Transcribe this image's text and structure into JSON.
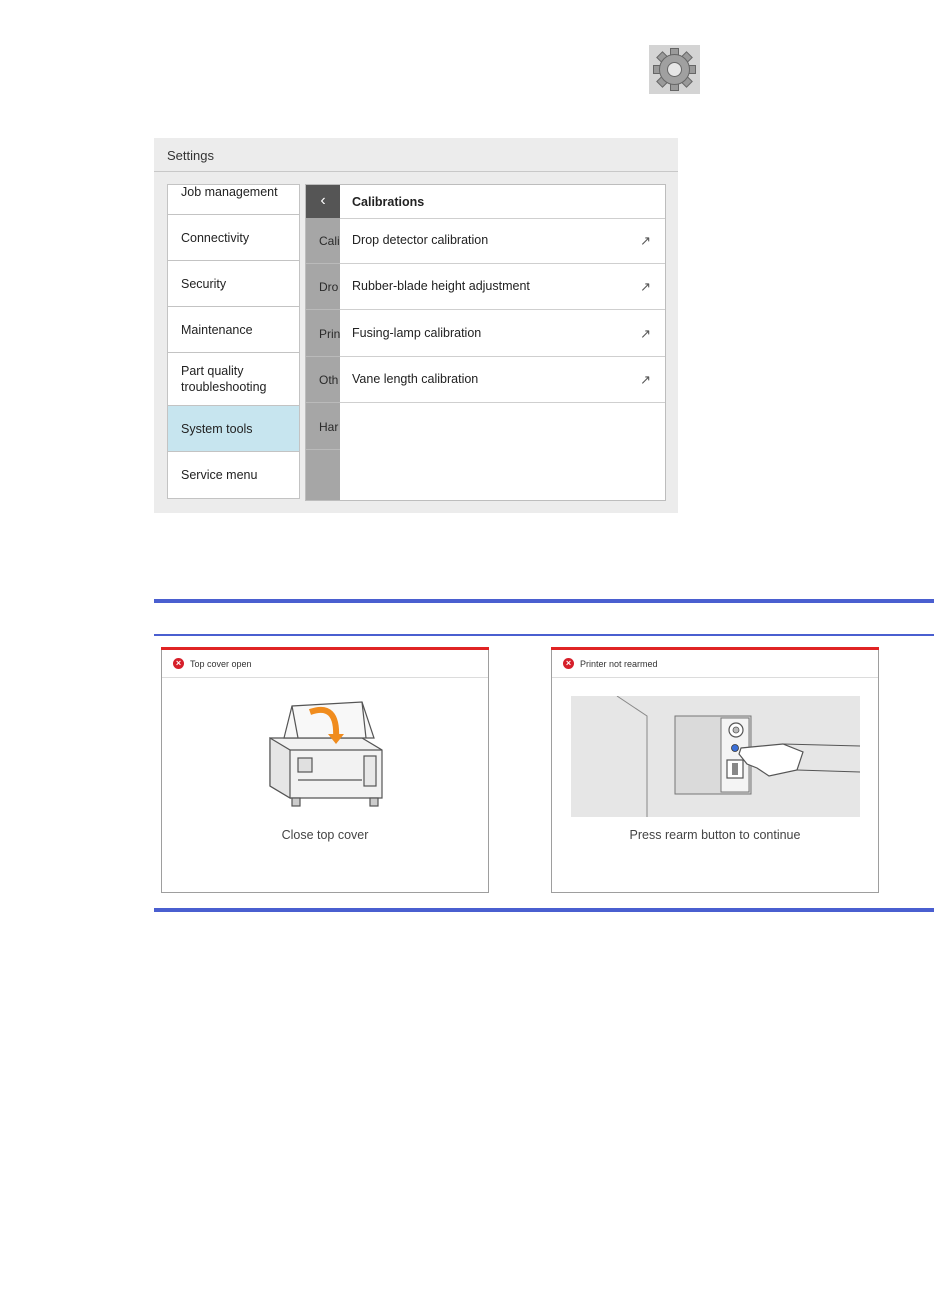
{
  "gear": {
    "icon": "gear-icon"
  },
  "settings": {
    "title": "Settings",
    "nav": [
      {
        "label": "Job management",
        "active": false
      },
      {
        "label": "Connectivity",
        "active": false
      },
      {
        "label": "Security",
        "active": false
      },
      {
        "label": "Maintenance",
        "active": false
      },
      {
        "label": "Part quality troubleshooting",
        "active": false
      },
      {
        "label": "System tools",
        "active": true
      },
      {
        "label": "Service menu",
        "active": false
      }
    ],
    "panel": {
      "back_icon": "chevron-left-icon",
      "back_glyph": "‹",
      "title": "Calibrations",
      "strip": [
        "Cali",
        "Dro",
        "Prin",
        "Oth",
        "Har"
      ],
      "items": [
        {
          "label": "Drop detector calibration",
          "icon": "external-arrow-icon",
          "glyph": "↗"
        },
        {
          "label": "Rubber-blade height adjustment",
          "icon": "external-arrow-icon",
          "glyph": "↗"
        },
        {
          "label": "Fusing-lamp calibration",
          "icon": "external-arrow-icon",
          "glyph": "↗"
        },
        {
          "label": "Vane length calibration",
          "icon": "external-arrow-icon",
          "glyph": "↗"
        }
      ]
    }
  },
  "alerts": [
    {
      "title": "Top cover open",
      "caption": "Close top cover",
      "icon": "error-icon",
      "glyph": "×"
    },
    {
      "title": "Printer not rearmed",
      "caption": "Press rearm button to continue",
      "icon": "error-icon",
      "glyph": "×"
    }
  ],
  "colors": {
    "accent_line": "#4a5fd0",
    "active_nav": "#c7e5ef",
    "error": "#d61f2a",
    "lid_arrow": "#f08c1e"
  }
}
